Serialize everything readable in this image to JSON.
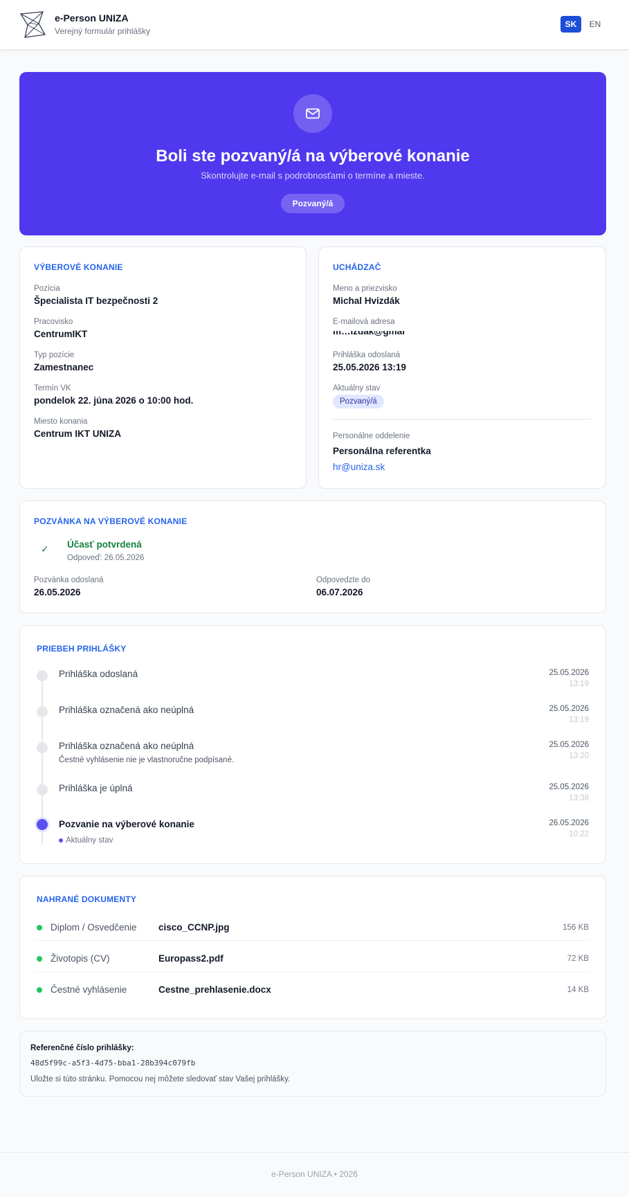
{
  "header": {
    "app_title": "e-Person UNIZA",
    "app_subtitle": "Verejný formulár prihlášky",
    "languages": [
      "SK",
      "EN"
    ],
    "active_language": "SK"
  },
  "hero": {
    "icon": "mail-icon",
    "title": "Boli ste pozvaný/á na výberové konanie",
    "subtitle": "Skontrolujte e-mail s podrobnosťami o termíne a mieste.",
    "badge": "Pozvaný/á",
    "color": "#5038ee"
  },
  "selection": {
    "section_title": "VÝBEROVÉ KONANIE",
    "fields": [
      {
        "label": "Pozícia",
        "value": "Špecialista IT bezpečnosti 2"
      },
      {
        "label": "Pracovisko",
        "value": "CentrumIKT"
      },
      {
        "label": "Typ pozície",
        "value": "Zamestnanec"
      },
      {
        "label": "Termín VK",
        "value": "pondelok 22. júna 2026 o 10:00 hod."
      },
      {
        "label": "Miesto konania",
        "value": "Centrum IKT UNIZA"
      }
    ]
  },
  "applicant": {
    "section_title": "UCHÁDZAČ",
    "name_label": "Meno a priezvisko",
    "name": "Michal Hvizdák",
    "email_label": "E-mailová adresa",
    "email": "m…izdak@gmai",
    "sent_label": "Prihláška odoslaná",
    "sent": "25.05.2026 13:19",
    "status_label": "Aktuálny stav",
    "status": "Pozvaný/á",
    "hr_label": "Personálne oddelenie",
    "hr_name": "Personálna referentka",
    "hr_email": "hr@uniza.sk"
  },
  "invitation": {
    "section_title": "POZVÁNKA NA VÝBEROVÉ KONANIE",
    "confirm_title": "Účasť potvrdená",
    "confirm_note": "Odpoveď: 26.05.2026",
    "sent_label": "Pozvánka odoslaná",
    "sent": "26.05.2026",
    "deadline_label": "Odpovedzte do",
    "deadline": "06.07.2026"
  },
  "timeline": {
    "section_title": "PRIEBEH PRIHLÁŠKY",
    "events": [
      {
        "text": "Prihláška odoslaná",
        "note": "",
        "date": "25.05.2026",
        "time": "13:19"
      },
      {
        "text": "Prihláška označená ako neúplná",
        "note": "",
        "date": "25.05.2026",
        "time": "13:19"
      },
      {
        "text": "Prihláška označená ako neúplná",
        "note": "Čestné vyhlásenie nie je vlastnoručne podpísané.",
        "date": "25.05.2026",
        "time": "13:20"
      },
      {
        "text": "Prihláška je úplná",
        "note": "",
        "date": "25.05.2026",
        "time": "13:38"
      },
      {
        "text": "Pozvanie na výberové konanie",
        "note": "",
        "date": "26.05.2026",
        "time": "10:22"
      }
    ],
    "current_note": "Aktuálny stav"
  },
  "documents": {
    "section_title": "NAHRANÉ DOKUMENTY",
    "items": [
      {
        "type": "Diplom / Osvedčenie",
        "file": "cisco_CCNP.jpg",
        "size": "156 KB"
      },
      {
        "type": "Životopis (CV)",
        "file": "Europass2.pdf",
        "size": "72 KB"
      },
      {
        "type": "Čestné vyhlásenie",
        "file": "Cestne_prehlasenie.docx",
        "size": "14 KB"
      }
    ]
  },
  "reference": {
    "label": "Referenčné číslo prihlášky:",
    "code": "48d5f99c-a5f3-4d75-bba1-28b394c079fb",
    "note": "Uložte si túto stránku. Pomocou nej môžete sledovať stav Vašej prihlášky."
  },
  "footer": {
    "text": "e-Person UNIZA • 2026"
  }
}
